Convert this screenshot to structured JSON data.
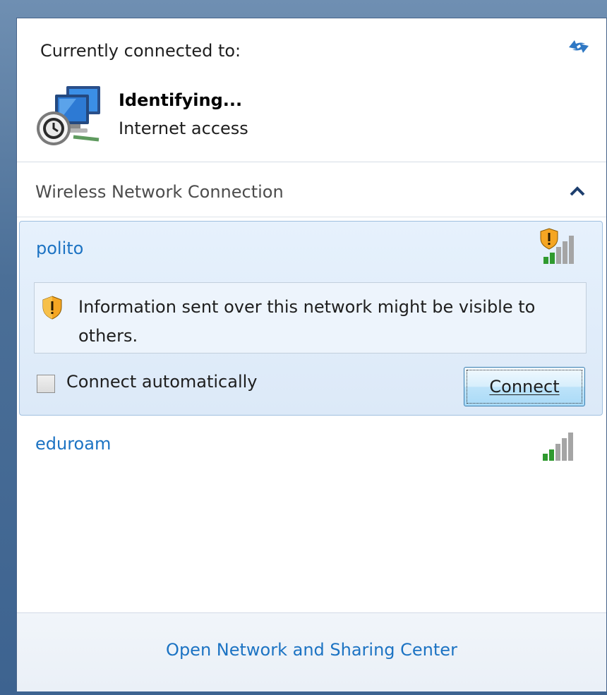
{
  "header": {
    "label": "Currently connected to:",
    "refresh_icon": "refresh-arrows-icon"
  },
  "current_connection": {
    "name": "Identifying...",
    "status": "Internet access",
    "icon": "network-identifying-icon"
  },
  "section": {
    "title": "Wireless Network Connection",
    "collapse_icon": "chevron-up-icon"
  },
  "networks": [
    {
      "name": "polito",
      "secured": false,
      "signal_bars": 2,
      "expanded": true,
      "warning": "Information sent over this network might be visible to others.",
      "auto_connect_label": "Connect automatically",
      "auto_connect_checked": false,
      "connect_label": "Connect",
      "connect_accesskey": "C"
    },
    {
      "name": "eduroam",
      "secured": true,
      "signal_bars": 2,
      "expanded": false
    }
  ],
  "footer": {
    "link": "Open Network and Sharing Center"
  },
  "colors": {
    "link": "#1c73c3",
    "selected_bg": "#dce9f8",
    "signal_on": "#2f9a2f",
    "signal_off": "#a5a5a5",
    "warning": "#f5a623"
  }
}
